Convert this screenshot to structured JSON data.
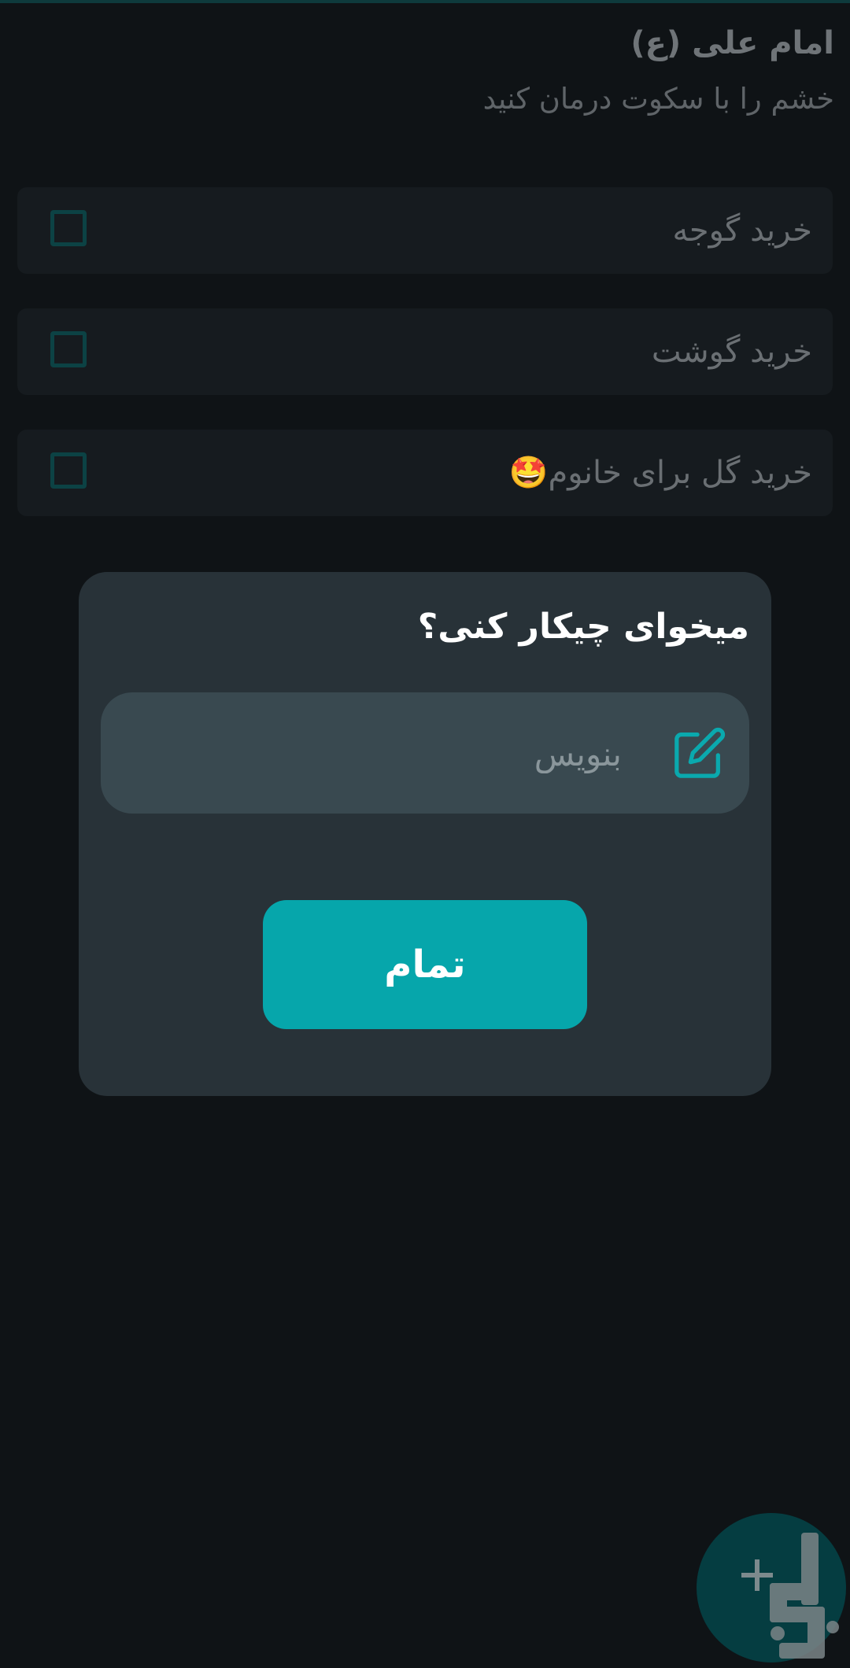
{
  "quote": {
    "author": "امام علی (ع)",
    "text": "خشم را با سکوت درمان کنید"
  },
  "tasks": [
    {
      "label": "خرید گوجه",
      "checked": false
    },
    {
      "label": "خرید گوشت",
      "checked": false
    },
    {
      "label": "خرید گل برای خانوم🤩",
      "checked": false
    }
  ],
  "dialog": {
    "title": "میخوای چیکار کنی؟",
    "input": {
      "placeholder": "بنویس",
      "value": "",
      "icon": "edit-pencil-icon"
    },
    "done_label": "تمام"
  },
  "fab": {
    "icon": "plus-icon"
  },
  "colors": {
    "background": "#0f1316",
    "accent": "#06a6ab",
    "dialog": "#283238",
    "input": "#394950",
    "fab": "#053d41"
  }
}
